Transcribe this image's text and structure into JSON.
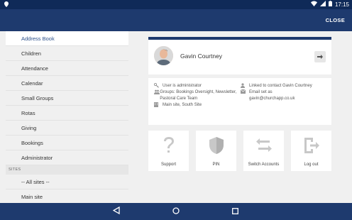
{
  "status_bar": {
    "time": "17:15",
    "icons": [
      "location-icon",
      "wifi-icon",
      "cell-signal-icon",
      "battery-icon"
    ]
  },
  "app_bar": {
    "close_label": "CLOSE"
  },
  "menu": {
    "items": [
      {
        "label": "Address Book",
        "active": true
      },
      {
        "label": "Children"
      },
      {
        "label": "Attendance"
      },
      {
        "label": "Calendar"
      },
      {
        "label": "Small Groups"
      },
      {
        "label": "Rotas"
      },
      {
        "label": "Giving"
      },
      {
        "label": "Bookings"
      },
      {
        "label": "Administrator"
      }
    ],
    "sites_header": "SITES",
    "sites": [
      {
        "label": "-- All sites --"
      },
      {
        "label": "Main site"
      }
    ]
  },
  "profile": {
    "name": "Gavin Courtney"
  },
  "info": {
    "is_admin": "User is administrator",
    "groups": "Groups: Bookings Oversight, Newsletter, Pastoral Care Team",
    "site": "Main site, South Site",
    "linked_contact": "Linked to contact Gavin Courtney",
    "email_label": "Email set as",
    "email": "gavin@churchapp.co.uk"
  },
  "tiles": [
    {
      "label": "Support",
      "icon": "question-icon"
    },
    {
      "label": "PIN",
      "icon": "shield-icon"
    },
    {
      "label": "Switch Accounts",
      "icon": "swap-icon"
    },
    {
      "label": "Log out",
      "icon": "logout-icon"
    }
  ],
  "colors": {
    "brand": "#1e3a6e",
    "status_bar": "#0f2a58",
    "background": "#f0f0f0"
  }
}
